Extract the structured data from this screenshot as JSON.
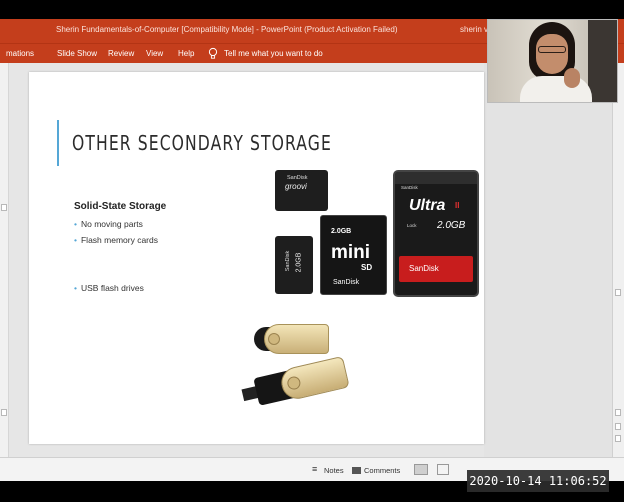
{
  "titlebar": {
    "title": "Sherin Fundamentals-of-Computer [Compatibility Mode]  -  PowerPoint (Product Activation Failed)",
    "user": "sherin v"
  },
  "ribbon": {
    "tabs": [
      "mations",
      "Slide Show",
      "Review",
      "View",
      "Help"
    ],
    "tell_me": "Tell me what you want to do"
  },
  "slide": {
    "title": "OTHER SECONDARY STORAGE",
    "section_heading": "Solid-State Storage",
    "bullets": [
      "No moving parts",
      "Flash memory cards",
      "USB flash drives"
    ]
  },
  "cards": {
    "sd": {
      "brand_top": "SanDisk",
      "name": "Ultra",
      "mark": "II",
      "lock": "Lock",
      "capacity": "2.0GB",
      "brand_bottom": "SanDisk"
    },
    "mini": {
      "capacity": "2.0GB",
      "name": "mini",
      "sub": "SD",
      "brand": "SanDisk"
    },
    "micro_top": {
      "brand": "SanDisk",
      "name": "groovi"
    },
    "micro_left": {
      "brand": "SanDisk",
      "capacity": "2.0GB"
    }
  },
  "statusbar": {
    "notes": "Notes",
    "comments": "Comments"
  },
  "timestamp": "2020-10-14  11:06:52",
  "colors": {
    "accent": "#c43e1c",
    "slide_accent": "#55a7d6"
  }
}
